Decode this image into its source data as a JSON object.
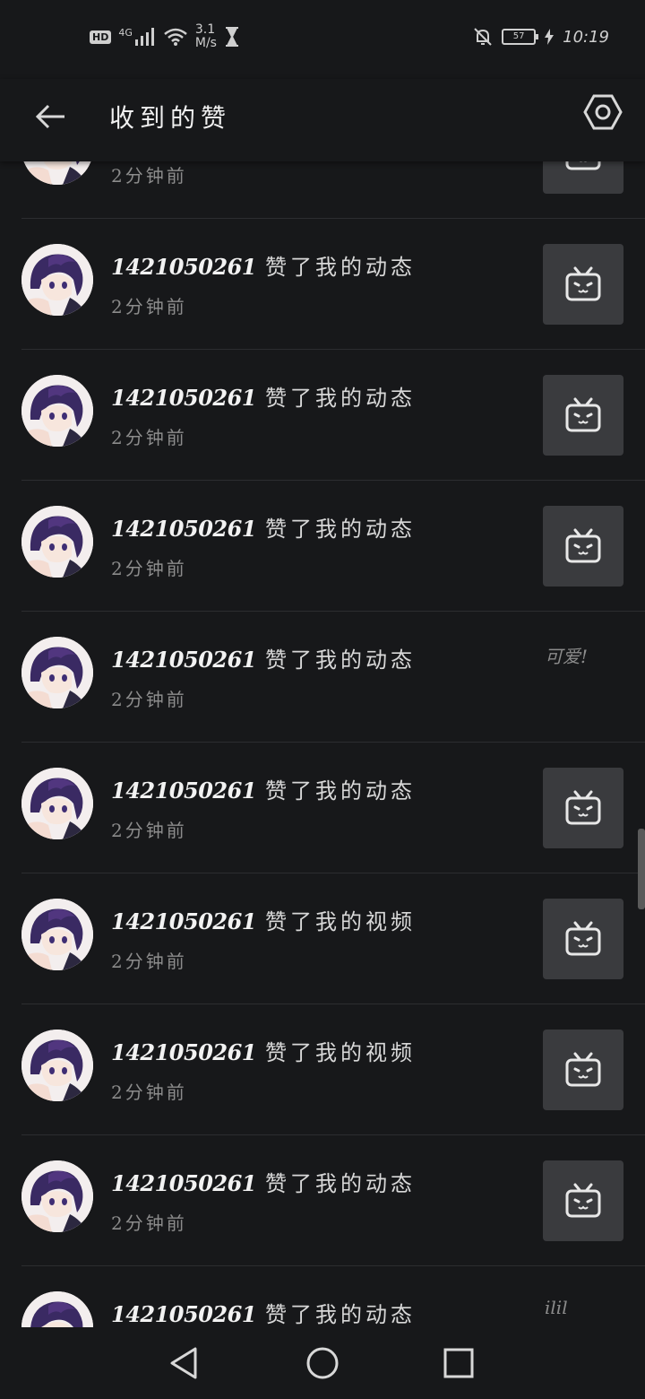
{
  "status_bar": {
    "hd": "HD",
    "network": "4G",
    "speed_value": "3.1",
    "speed_unit": "M/s",
    "battery": "57",
    "time": "10:19"
  },
  "header": {
    "title": "收到的赞"
  },
  "rows": [
    {
      "uid": "",
      "action": "",
      "time": "2分钟前",
      "thumb": "tv-icon",
      "note": ""
    },
    {
      "uid": "1421050261",
      "action": "赞了我的动态",
      "time": "2分钟前",
      "thumb": "tv-icon",
      "note": ""
    },
    {
      "uid": "1421050261",
      "action": "赞了我的动态",
      "time": "2分钟前",
      "thumb": "tv-icon",
      "note": ""
    },
    {
      "uid": "1421050261",
      "action": "赞了我的动态",
      "time": "2分钟前",
      "thumb": "tv-icon",
      "note": ""
    },
    {
      "uid": "1421050261",
      "action": "赞了我的动态",
      "time": "2分钟前",
      "thumb": "",
      "note": "可爱!"
    },
    {
      "uid": "1421050261",
      "action": "赞了我的动态",
      "time": "2分钟前",
      "thumb": "tv-icon",
      "note": ""
    },
    {
      "uid": "1421050261",
      "action": "赞了我的视频",
      "time": "2分钟前",
      "thumb": "tv-icon",
      "note": ""
    },
    {
      "uid": "1421050261",
      "action": "赞了我的视频",
      "time": "2分钟前",
      "thumb": "tv-icon",
      "note": ""
    },
    {
      "uid": "1421050261",
      "action": "赞了我的动态",
      "time": "2分钟前",
      "thumb": "tv-icon",
      "note": ""
    },
    {
      "uid": "1421050261",
      "action": "赞了我的动态",
      "time": "",
      "thumb": "",
      "note": "ilil"
    }
  ],
  "colors": {
    "background": "#17181a",
    "thumb_bg": "#3a3b3e",
    "divider": "#2c2d30"
  }
}
